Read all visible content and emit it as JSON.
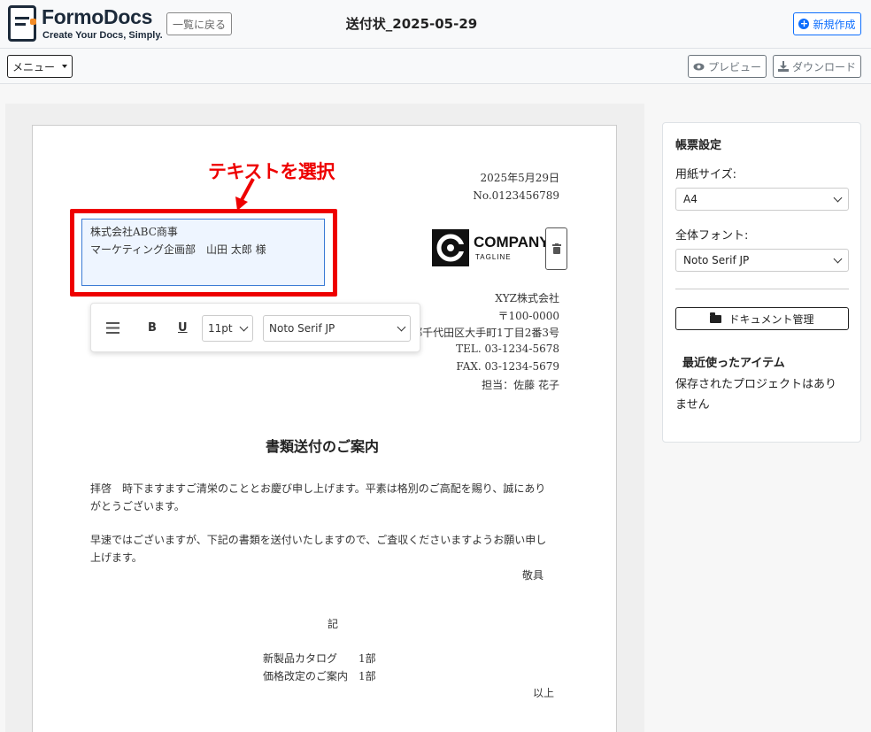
{
  "header": {
    "brand_name": "FormoDocs",
    "brand_tagline": "Create Your Docs, Simply.",
    "back_label": "一覧に戻る",
    "doc_title": "送付状_2025-05-29",
    "new_label": "新規作成"
  },
  "subbar": {
    "menu_label": "メニュー",
    "preview_label": "プレビュー",
    "download_label": "ダウンロード"
  },
  "annotation": {
    "text": "テキストを選択",
    "color": "#e00000"
  },
  "document": {
    "date": "2025年5月29日",
    "number": "No.0123456789",
    "recipient": {
      "line1": "株式会社ABC商事",
      "line2": "マーケティング企画部　山田 太郎 様"
    },
    "logo": {
      "name": "COMPANY",
      "tagline": "TAGLINE"
    },
    "sender": {
      "company": "XYZ株式会社",
      "postal": "〒100-0000",
      "address": "東京都千代田区大手町1丁目2番3号",
      "tel": "TEL. 03-1234-5678",
      "fax": "FAX. 03-1234-5679",
      "contact": "担当：佐藤 花子"
    },
    "title": "書類送付のご案内",
    "body1_line1": "拝啓　時下ますますご清栄のこととお慶び申し上げます。平素は格別のご高配を賜り、誠にあり",
    "body1_line2": "がとうございます。",
    "body2_line1": "早速ではございますが、下記の書類を送付いたしますので、ご査収くださいますようお願い申し",
    "body2_line2": "上げます。",
    "closing": "敬具",
    "ki": "記",
    "items": [
      "新製品カタログ　　1部",
      "価格改定のご案内　1部"
    ],
    "end": "以上"
  },
  "toolbar": {
    "bold": "B",
    "underline": "U",
    "font_size": "11pt",
    "font_family": "Noto Serif JP"
  },
  "sidebar": {
    "heading": "帳票設定",
    "paper_label": "用紙サイズ:",
    "paper_value": "A4",
    "font_label": "全体フォント:",
    "font_value": "Noto Serif JP",
    "doc_mgr_label": "ドキュメント管理",
    "recent_heading": "最近使ったアイテム",
    "recent_empty_line1": "保存されたプロジェクトはあり",
    "recent_empty_line2": "ません"
  }
}
